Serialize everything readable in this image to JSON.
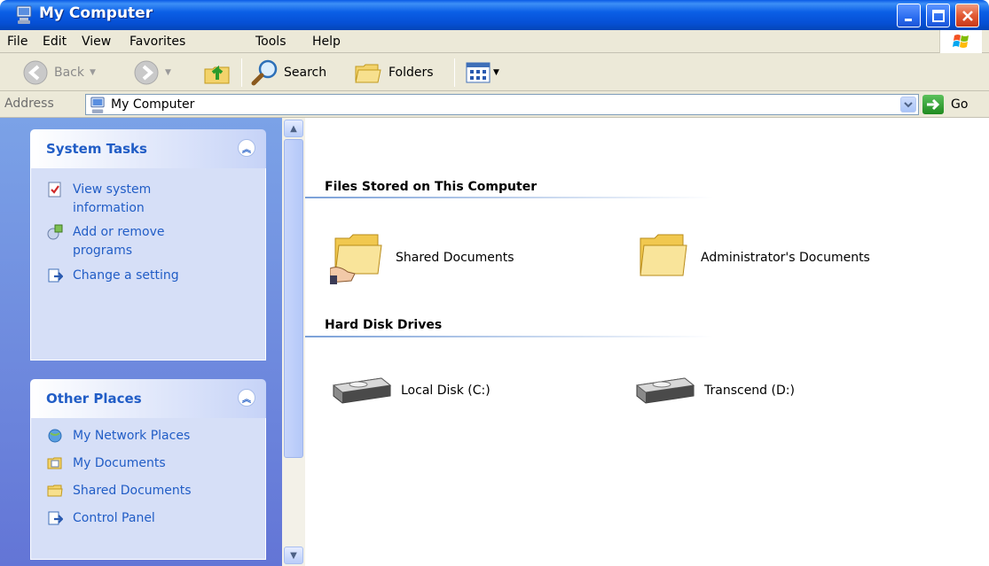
{
  "window": {
    "title": "My Computer"
  },
  "menu": {
    "items": [
      "File",
      "Edit",
      "View",
      "Favorites",
      "Tools",
      "Help"
    ]
  },
  "toolbar": {
    "back_label": "Back",
    "search_label": "Search",
    "folders_label": "Folders"
  },
  "address": {
    "label": "Address",
    "value": "My Computer",
    "go_label": "Go"
  },
  "task_pane": {
    "system_tasks": {
      "title": "System Tasks",
      "items": [
        {
          "label": "View system information",
          "icon": "system-info-icon"
        },
        {
          "label": "Add or remove programs",
          "icon": "add-remove-programs-icon"
        },
        {
          "label": "Change a setting",
          "icon": "control-panel-icon"
        }
      ]
    },
    "other_places": {
      "title": "Other Places",
      "items": [
        {
          "label": "My Network Places",
          "icon": "network-places-icon"
        },
        {
          "label": "My Documents",
          "icon": "my-documents-icon"
        },
        {
          "label": "Shared Documents",
          "icon": "folder-icon"
        },
        {
          "label": "Control Panel",
          "icon": "control-panel-icon"
        }
      ]
    }
  },
  "content": {
    "groups": [
      {
        "title": "Files Stored on This Computer",
        "items": [
          {
            "label": "Shared Documents",
            "icon": "shared-folder-icon"
          },
          {
            "label": "Administrator's Documents",
            "icon": "folder-icon"
          }
        ]
      },
      {
        "title": "Hard Disk Drives",
        "items": [
          {
            "label": "Local Disk (C:)",
            "icon": "hard-disk-icon"
          },
          {
            "label": "Transcend (D:)",
            "icon": "hard-disk-icon"
          }
        ]
      }
    ]
  },
  "colors": {
    "titlebar": "#0b5fe6",
    "task_link": "#215dc6",
    "chrome": "#ece9d8"
  }
}
